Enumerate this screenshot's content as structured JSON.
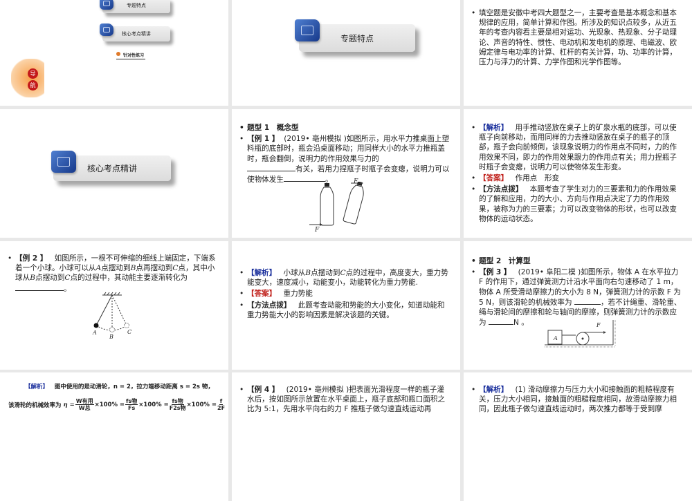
{
  "slides": {
    "s1": {
      "menu": [
        "专题特点",
        "核心考点精讲"
      ],
      "practice_link": "针对性练习",
      "nav_badge": "导航"
    },
    "s2": {
      "banner": "专题特点"
    },
    "s3": {
      "text": "填空题是安徽中考四大题型之一，主要考查是基本概念和基本规律的应用，简单计算和作图。所涉及的知识点较多，从近五年的考查内容看主要是相对运功、光现象、热现象、分子动理论、声音的特性、惯性、电动机和发电机的原理、电磁波、欧姆定律与电功率的计算、杠杆的有关计算，功、功率的计算，压力与浮力的计算、力学作图和光学作图等。"
    },
    "s4": {
      "banner": "核心考点精讲"
    },
    "s5": {
      "heading": "题型 1　概念型",
      "tag": "【例 1 】",
      "source": "(2019• 亳州模拟 )",
      "text1": "如图所示，用水平力推桌面上塑料瓶的底部时，瓶会沿桌面移动；用同样大小的水平力推瓶盖时，瓶会翻倒，说明力的作用效果与力的",
      "text2": "有关，若用力捏瓶子时瓶子会变瘪，说明力可以使物体发生",
      "end": "。",
      "force_label": "F"
    },
    "s6": {
      "analysis_tag": "【解析】",
      "analysis": "用手推动竖放在桌子上的矿泉水瓶的底部，可以使瓶子向前移动，而用同样的力去推动竖放在桌子的瓶子的顶部，瓶子会向前倾倒，该现象说明力的作用点不同时，力的作用效果不同，即力的作用效果跟力的作用点有关；用力捏瓶子时瓶子会变瘪，说明力可以使物体发生形变。",
      "answer_tag": "【答案】",
      "answer": "作用点　形变",
      "method_tag": "【方法点拨】",
      "method": "本题考查了学生对力的三要素和力的作用效果的了解和应用，力的大小、方向与作用点决定了力的作用效果，被称为力的三要素；力可以改变物体的形状，也可以改变物体的运动状态。"
    },
    "s7": {
      "tag": "【例 2 】",
      "text1": "如图所示，一根不可伸缩的细线上端固定，下端系着一个小球。小球可以从",
      "A": "A",
      "text2": "点摆动到",
      "B": "B",
      "text3": "点再摆动到",
      "C": "C",
      "text4": "点，其中小球从",
      "text5": "点摆动到",
      "text6": "点的过程中，其动能主要逐渐转化为",
      "end": "。"
    },
    "s8": {
      "analysis_tag": "【解析】",
      "analysis_pre": "小球从",
      "B": "B",
      "analysis_mid": "点摆动到",
      "C": "C",
      "analysis": "点的过程中，高度变大，重力势能变大，速度减小，动能变小，动能转化为重力势能.",
      "answer_tag": "【答案】",
      "answer": "重力势能",
      "method_tag": "【方法点拨】",
      "method": "此题考查动能和势能的大小变化，知道动能和重力势能大小的影响因素是解决该题的关键。"
    },
    "s9": {
      "heading": "题型 2　计算型",
      "tag": "【例 3 】",
      "source": "(2019• 阜阳二模 )",
      "text": "如图所示，物体 A 在水平拉力 F 的作用下，通过弹簧测力计沿水平面向右匀速移动了 1 m，物体 A 所受滑动摩擦力的大小为 8 N，弹簧测力计的示数 F 为 5 N，则该滑轮的机械效率为",
      "text2": "，若不计绳重、滑轮重、绳与滑轮间的摩擦和轮与轴间的摩擦，则弹簧测力计的示数应为",
      "end": "N 。",
      "block_label": "A",
      "force_label": "F"
    },
    "s10": {
      "analysis_tag": "【解析】",
      "line1": "图中使用的是动滑轮，n = 2，拉力端移动距离 s = 2s 物，",
      "line2_pre": "该滑轮的机械效率为",
      "eta": "η =",
      "f1n": "W有用",
      "f1d": "W总",
      "f2n": "fs物",
      "f2d": "Fs",
      "f3n": "fs物",
      "f3d": "F2s物",
      "f4n": "f",
      "f4d": "2F",
      "times": "×100% ="
    },
    "s11": {
      "tag": "【例 4 】",
      "source": "(2019• 亳州模拟 )",
      "text": "把表面光滑程度一样的瓶子灌水后，按如图所示放置在水平桌面上，瓶子底部和瓶口面积之比为 5:1，先用水平向右的力 F 推瓶子做匀速直线运动再"
    },
    "s12": {
      "analysis_tag": "【解析】",
      "text": "(1) 滑动摩擦力与压力大小和接触面的粗糙程度有关，压力大小相同，接触面的粗糙程度相同，故滑动摩擦力相同，因此瓶子做匀速直线运动时，两次推力都等于受到摩"
    }
  },
  "colors": {
    "blue_tag": "#1a2f9c",
    "red_tag": "#c0201b",
    "gap": "#e8e8e8"
  }
}
